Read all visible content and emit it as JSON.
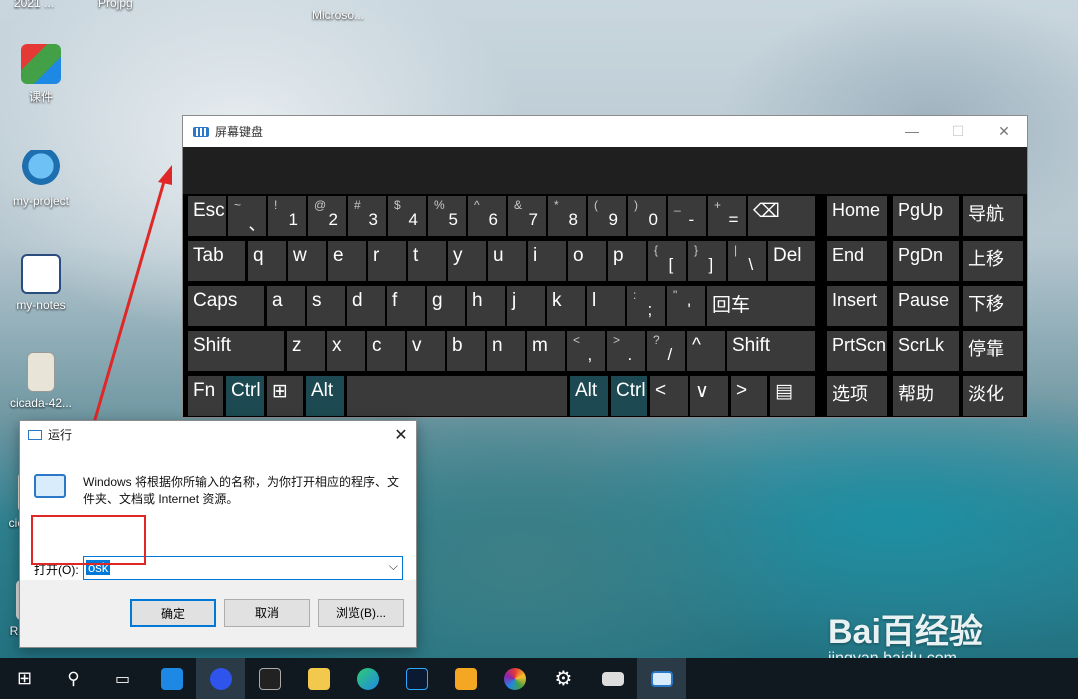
{
  "desktop": {
    "top_labels": [
      "2021 ...",
      "Projpg",
      "Microso..."
    ],
    "icons": [
      {
        "label": "课件"
      },
      {
        "label": "my-project"
      },
      {
        "label": "my-notes"
      },
      {
        "label": "cicada-42..."
      },
      {
        "label": "cic"
      },
      {
        "label": "R"
      }
    ]
  },
  "osk": {
    "title": "屏幕键盘",
    "controls": [
      "—",
      "☐",
      "✕"
    ],
    "rows": {
      "r1": [
        {
          "main": "Esc"
        },
        {
          "top": "~",
          "main": "、"
        },
        {
          "top": "!",
          "main": "1"
        },
        {
          "top": "@",
          "main": "2"
        },
        {
          "top": "#",
          "main": "3"
        },
        {
          "top": "$",
          "main": "4"
        },
        {
          "top": "%",
          "main": "5"
        },
        {
          "top": "^",
          "main": "6"
        },
        {
          "top": "&",
          "main": "7"
        },
        {
          "top": "*",
          "main": "8"
        },
        {
          "top": "(",
          "main": "9"
        },
        {
          "top": ")",
          "main": "0"
        },
        {
          "top": "_",
          "main": "-"
        },
        {
          "top": "+",
          "main": "="
        },
        {
          "main": "⌫"
        }
      ],
      "r2": [
        {
          "main": "Tab"
        },
        {
          "main": "q"
        },
        {
          "main": "w"
        },
        {
          "main": "e"
        },
        {
          "main": "r"
        },
        {
          "main": "t"
        },
        {
          "main": "y"
        },
        {
          "main": "u"
        },
        {
          "main": "i"
        },
        {
          "main": "o"
        },
        {
          "main": "p"
        },
        {
          "top": "{",
          "main": "["
        },
        {
          "top": "}",
          "main": "]"
        },
        {
          "top": "|",
          "main": "\\"
        },
        {
          "main": "Del"
        }
      ],
      "r3": [
        {
          "main": "Caps"
        },
        {
          "main": "a"
        },
        {
          "main": "s"
        },
        {
          "main": "d"
        },
        {
          "main": "f"
        },
        {
          "main": "g"
        },
        {
          "main": "h"
        },
        {
          "main": "j"
        },
        {
          "main": "k"
        },
        {
          "main": "l"
        },
        {
          "top": ":",
          "main": ";"
        },
        {
          "top": "\"",
          "main": "'"
        },
        {
          "main": "回车"
        }
      ],
      "r4": [
        {
          "main": "Shift"
        },
        {
          "main": "z"
        },
        {
          "main": "x"
        },
        {
          "main": "c"
        },
        {
          "main": "v"
        },
        {
          "main": "b"
        },
        {
          "main": "n"
        },
        {
          "main": "m"
        },
        {
          "top": "<",
          "main": ","
        },
        {
          "top": ">",
          "main": "."
        },
        {
          "top": "?",
          "main": "/"
        },
        {
          "main": "^"
        },
        {
          "main": "Shift"
        }
      ],
      "r5": [
        {
          "main": "Fn"
        },
        {
          "main": "Ctrl"
        },
        {
          "main": "⊞"
        },
        {
          "main": "Alt"
        },
        {
          "main": ""
        },
        {
          "main": "Alt"
        },
        {
          "main": "Ctrl"
        },
        {
          "main": "<"
        },
        {
          "main": "∨"
        },
        {
          "main": ">"
        },
        {
          "main": "▤"
        }
      ]
    },
    "nav": [
      [
        "Home",
        "PgUp",
        "导航"
      ],
      [
        "End",
        "PgDn",
        "上移"
      ],
      [
        "Insert",
        "Pause",
        "下移"
      ],
      [
        "PrtScn",
        "ScrLk",
        "停靠"
      ],
      [
        "选项",
        "帮助",
        "淡化"
      ]
    ]
  },
  "run": {
    "title": "运行",
    "description": "Windows 将根据你所输入的名称，为你打开相应的程序、文件夹、文档或 Internet 资源。",
    "open_label": "打开(O):",
    "input_value": "osk",
    "buttons": {
      "ok": "确定",
      "cancel": "取消",
      "browse": "浏览(B)..."
    }
  },
  "watermark": {
    "brand": "Bai百经验",
    "url": "jingyan.baidu.com"
  },
  "colors": {
    "accent": "#0078d7",
    "annotation": "#e02727",
    "osk_key": "#3a3a3a",
    "osk_key_active": "#1d4a52"
  }
}
